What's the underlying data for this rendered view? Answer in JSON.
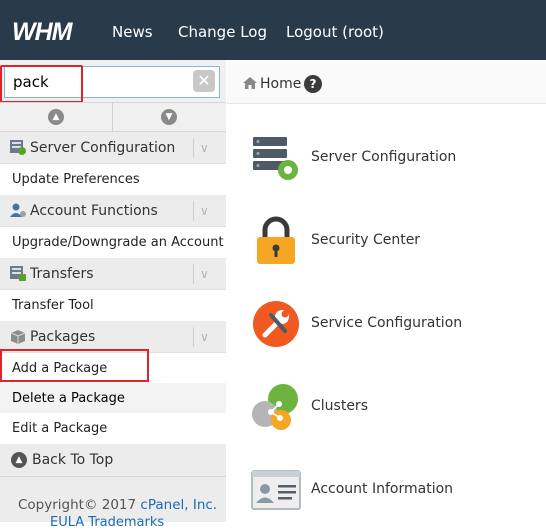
{
  "header": {
    "logo": "WHM",
    "nav": [
      "News",
      "Change Log",
      "Logout (root)"
    ]
  },
  "sidebar": {
    "search_value": "pack",
    "clear_icon": "close-icon",
    "categories": [
      {
        "label": "Server Configuration",
        "icon": "server-config-icon",
        "items": [
          "Update Preferences"
        ]
      },
      {
        "label": "Account Functions",
        "icon": "account-functions-icon",
        "items": [
          "Upgrade/Downgrade an Account"
        ]
      },
      {
        "label": "Transfers",
        "icon": "transfers-icon",
        "items": [
          "Transfer Tool"
        ]
      },
      {
        "label": "Packages",
        "icon": "packages-icon",
        "items": [
          "Add a Package",
          "Delete a Package",
          "Edit a Package"
        ]
      }
    ],
    "back_to_top": "Back To Top",
    "footer": {
      "copyright": "Copyright© 2017",
      "company": "cPanel, Inc.",
      "links": "EULA  Trademarks"
    }
  },
  "breadcrumb": {
    "home": "Home",
    "help": "?"
  },
  "apps": [
    {
      "label": "Server Configuration",
      "icon": "server-configuration-icon"
    },
    {
      "label": "Security Center",
      "icon": "padlock-icon"
    },
    {
      "label": "Service Configuration",
      "icon": "wrench-icon"
    },
    {
      "label": "Clusters",
      "icon": "clusters-icon"
    },
    {
      "label": "Account Information",
      "icon": "id-card-icon"
    }
  ],
  "colors": {
    "topbar": "#293a4a",
    "highlight": "#e0242a",
    "link": "#1a6bb8",
    "padlock": "#f5a623",
    "wrench": "#f05a22",
    "cluster_green": "#6cb33f"
  }
}
